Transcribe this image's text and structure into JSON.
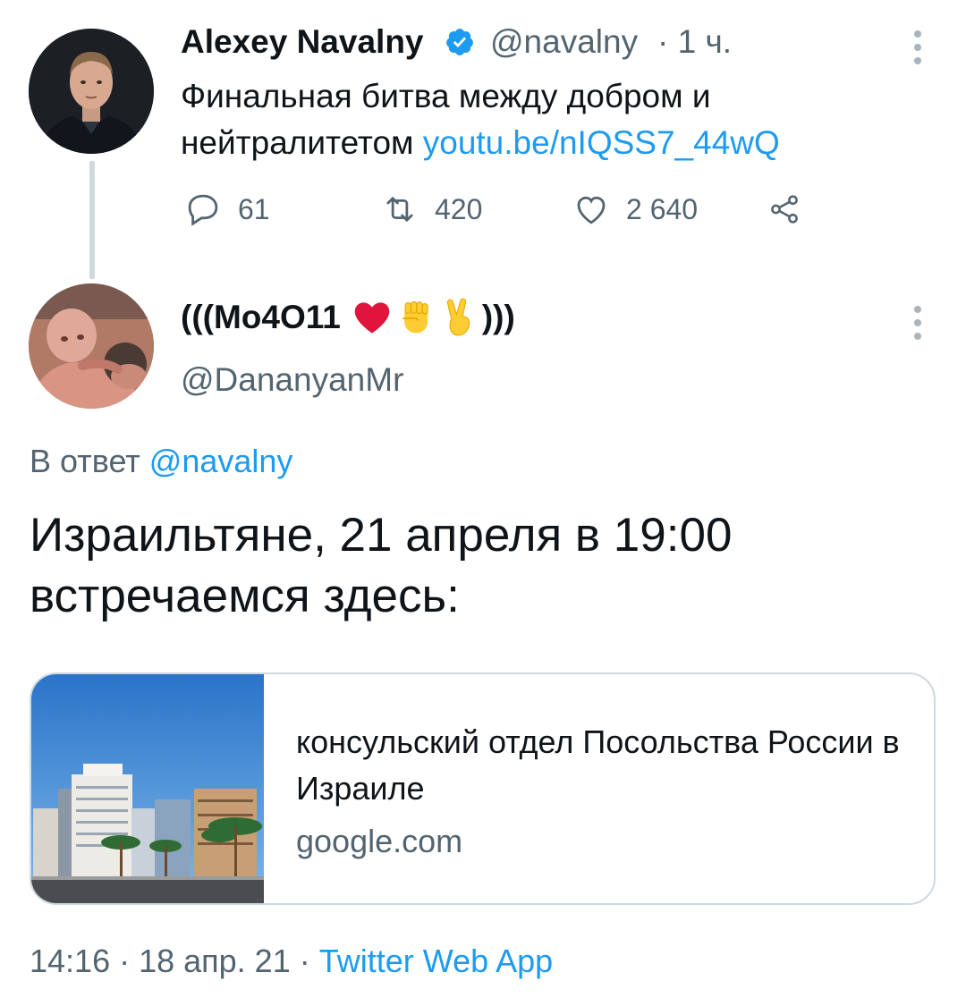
{
  "parent_tweet": {
    "author_name": "Alexey Navalny",
    "handle": "@navalny",
    "separator": "·",
    "time": "1 ч.",
    "text_part1": "Финальная битва между добром и",
    "text_part2": "нейтралитетом ",
    "link": "youtu.be/nIQSS7_44wQ",
    "actions": {
      "replies": "61",
      "retweets": "420",
      "likes": "2 640"
    }
  },
  "reply_tweet": {
    "author_name_open": "(((Мо4О11",
    "author_name_close": ")))",
    "handle": "@DananyanMr",
    "replying_prefix": "В ответ ",
    "replying_to": "@navalny",
    "text": "Израильтяне, 21 апреля в 19:00 встречаемся здесь:",
    "card": {
      "title": "консульский отдел Посольства России в Израиле",
      "domain": "google.com"
    },
    "footer": {
      "time": "14:16",
      "sep1": " · ",
      "date": "18 апр. 21",
      "sep2": " · ",
      "source": "Twitter Web App"
    }
  },
  "colors": {
    "link": "#1d9bf0",
    "muted": "#536471",
    "text": "#0f1419",
    "border": "#cfd9de",
    "heart_emoji": "#e0143c"
  },
  "icons": [
    "verified-badge-icon",
    "kebab-menu-icon",
    "reply-icon",
    "retweet-icon",
    "like-icon",
    "share-icon",
    "red-heart-emoji-icon",
    "raised-fist-emoji-icon",
    "victory-hand-emoji-icon"
  ]
}
